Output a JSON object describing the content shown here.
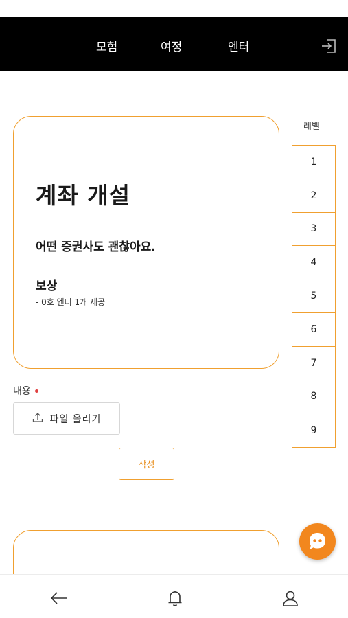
{
  "nav": {
    "items": [
      "모험",
      "여정",
      "엔터"
    ],
    "logout_icon": "logout-icon"
  },
  "mission": {
    "title": "계좌 개설",
    "description": "어떤 증권사도 괜찮아요.",
    "reward_title": "보상",
    "reward_item": "- 0호 엔터 1개 제공"
  },
  "levels": {
    "label": "레벨",
    "items": [
      "1",
      "2",
      "3",
      "4",
      "5",
      "6",
      "7",
      "8",
      "9"
    ]
  },
  "form": {
    "content_label": "내용",
    "upload_label": "파일 올리기",
    "submit_label": "작성"
  },
  "bottom_nav": {
    "icons": [
      "back-arrow-icon",
      "bell-icon",
      "user-icon"
    ]
  },
  "colors": {
    "accent": "#f0a030",
    "fab": "#f2871e",
    "required": "#e04040",
    "topbar": "#000000"
  }
}
